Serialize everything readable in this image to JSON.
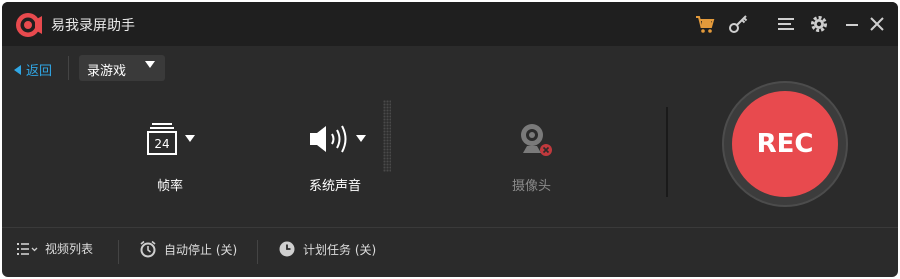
{
  "app": {
    "title": "易我录屏助手"
  },
  "titlebar_icons": [
    "cart-icon",
    "key-icon",
    "menu-icon",
    "gear-icon",
    "minimize-icon",
    "close-icon"
  ],
  "nav": {
    "back_label": "返回",
    "mode_value": "录游戏"
  },
  "options": {
    "frame_rate": {
      "label": "帧率",
      "value": "24"
    },
    "system_audio": {
      "label": "系统声音"
    },
    "webcam": {
      "label": "摄像头"
    }
  },
  "rec": {
    "label": "REC"
  },
  "bottom": {
    "video_list": "视频列表",
    "auto_stop": "自动停止 (关)",
    "schedule": "计划任务 (关)"
  },
  "colors": {
    "accent": "#30a7e5",
    "rec": "#e84a4e",
    "cart": "#e39a3b"
  }
}
